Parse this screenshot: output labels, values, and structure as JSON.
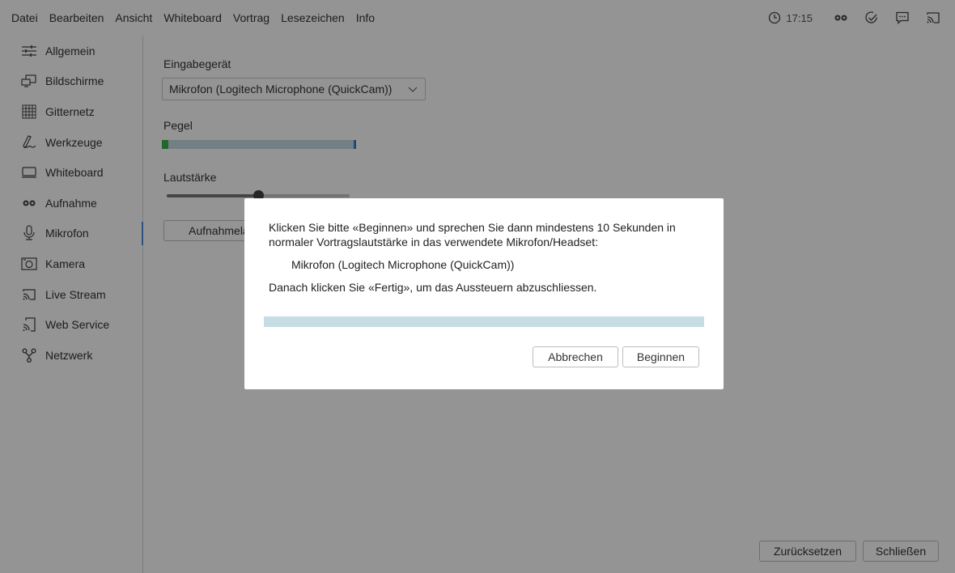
{
  "menu": {
    "items": [
      "Datei",
      "Bearbeiten",
      "Ansicht",
      "Whiteboard",
      "Vortrag",
      "Lesezeichen",
      "Info"
    ],
    "time": "17:15",
    "icons": [
      "clock-icon",
      "record-icon",
      "checkmark-icon",
      "chat-icon",
      "cast-icon"
    ]
  },
  "sidebar": {
    "items": [
      {
        "label": "Allgemein",
        "icon": "sliders-icon"
      },
      {
        "label": "Bildschirme",
        "icon": "screens-icon"
      },
      {
        "label": "Gitternetz",
        "icon": "grid-icon"
      },
      {
        "label": "Werkzeuge",
        "icon": "pen-icon"
      },
      {
        "label": "Whiteboard",
        "icon": "whiteboard-icon"
      },
      {
        "label": "Aufnahme",
        "icon": "record-icon"
      },
      {
        "label": "Mikrofon",
        "icon": "microphone-icon"
      },
      {
        "label": "Kamera",
        "icon": "camera-icon"
      },
      {
        "label": "Live Stream",
        "icon": "cast-icon"
      },
      {
        "label": "Web Service",
        "icon": "web-service-icon"
      },
      {
        "label": "Netzwerk",
        "icon": "network-icon"
      }
    ],
    "active_index": 6
  },
  "microphone": {
    "input_label": "Eingabegerät",
    "input_value": "Mikrofon (Logitech Microphone (QuickCam))",
    "level_label": "Pegel",
    "level_fraction": 0.03,
    "volume_label": "Lautstärke",
    "volume_fraction": 0.5,
    "calibrate_button": "Aufnahmelau"
  },
  "footer": {
    "reset_button": "Zurücksetzen",
    "close_button": "Schließen"
  },
  "dialog": {
    "line1": "Klicken Sie bitte «Beginnen» und sprechen Sie dann mindestens 10 Sekunden in",
    "line2": "normaler Vortragslautstärke in das verwendete Mikrofon/Headset:",
    "device": "Mikrofon (Logitech Microphone (QuickCam))",
    "line3": "Danach klicken Sie «Fertig», um das Aussteuern abzuschliessen.",
    "progress_fraction": 0,
    "cancel_button": "Abbrechen",
    "start_button": "Beginnen"
  },
  "colors": {
    "meter_bg": "#c5dde3",
    "level_green": "#3bb04a",
    "peak_blue": "#3a7fcf",
    "active_indicator": "#4a8fd8"
  }
}
